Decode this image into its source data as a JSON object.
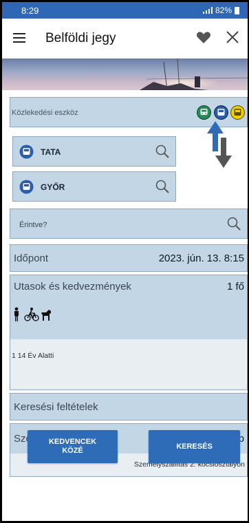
{
  "statusbar": {
    "time": "8:29",
    "battery": "82%"
  },
  "appbar": {
    "title": "Belföldi jegy"
  },
  "transport": {
    "label": "Közlekedési eszköz",
    "modes": [
      "train-icon",
      "bus-icon",
      "bus-yellow-icon"
    ]
  },
  "route": {
    "from": "TATA",
    "to": "GYŐR",
    "via_placeholder": "Érintve?"
  },
  "date": {
    "label": "Időpont",
    "value": "2023. jún. 13.  8:15"
  },
  "passengers": {
    "label": "Utasok és kedvezmények",
    "count": "1 fő",
    "icons": [
      "person-icon",
      "bicycle-icon",
      "dog-icon"
    ],
    "detail": "1 14 Év Alatti"
  },
  "search_conditions": {
    "label": "Keresési feltételek"
  },
  "services": {
    "label": "Szolgáltatások",
    "count": "1 db",
    "detail": "Személyszállítás 2. kocsiosztályon"
  },
  "buttons": {
    "favorite": "KEDVENCEK\nKÖZÉ",
    "search": "KERESÉS"
  },
  "colors": {
    "primary": "#2f6cb8",
    "card": "#c2d6e6",
    "banner": "#9aa8c6"
  }
}
